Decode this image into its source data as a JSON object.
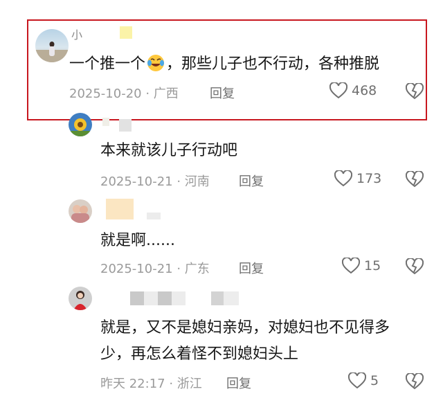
{
  "comments": [
    {
      "name": "小",
      "text_parts": [
        "一个推一个",
        "，那些儿子也不行动，各种推脱"
      ],
      "emoji": "laughing-crying-face",
      "date_location": "2025-10-20 · 广西",
      "reply_label": "回复",
      "likes": "468",
      "highlighted": true
    },
    {
      "text": "本来就该儿子行动吧",
      "date_location": "2025-10-21 · 河南",
      "reply_label": "回复",
      "likes": "173"
    },
    {
      "text": "就是啊......",
      "date_location": "2025-10-21 · 广东",
      "reply_label": "回复",
      "likes": "15"
    },
    {
      "text_lines": [
        "就是，又不是媳妇亲妈，对媳妇也不见得多",
        "少，再怎么着怪不到媳妇头上"
      ],
      "date_location": "昨天 22:17 · 浙江",
      "reply_label": "回复",
      "likes": "5"
    }
  ],
  "colors": {
    "highlight": "#c8171f",
    "meta": "#9a9a9a",
    "action": "#6f6f6f"
  },
  "icons": [
    "heart-outline-icon",
    "broken-heart-icon"
  ]
}
